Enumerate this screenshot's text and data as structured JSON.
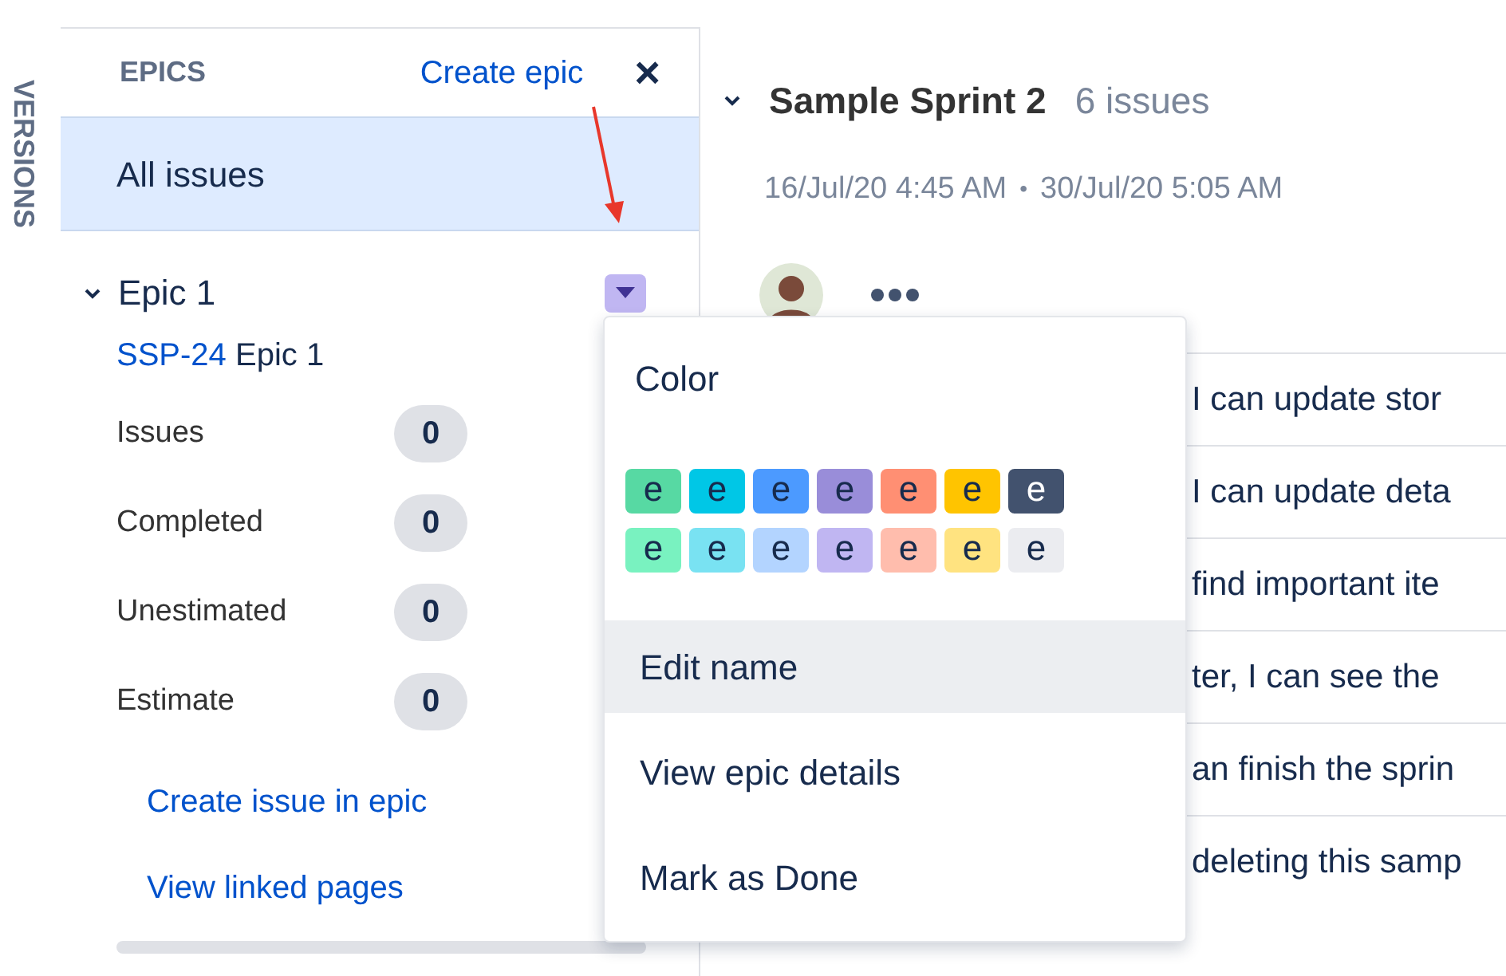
{
  "side_tab": {
    "label": "VERSIONS"
  },
  "epics_panel": {
    "title": "EPICS",
    "create_link": "Create epic",
    "close": "×",
    "all_issues": {
      "label": "All issues",
      "selected": true
    },
    "epic": {
      "name": "Epic 1",
      "expanded": true,
      "key": "SSP-24",
      "summary": "Epic 1",
      "color": "#c0b6f2",
      "stats": [
        {
          "label": "Issues",
          "count": "0"
        },
        {
          "label": "Completed",
          "count": "0"
        },
        {
          "label": "Unestimated",
          "count": "0"
        },
        {
          "label": "Estimate",
          "count": "0"
        }
      ],
      "links": [
        "Create issue in epic",
        "View linked pages"
      ]
    }
  },
  "sprint": {
    "name": "Sample Sprint 2",
    "count": "6 issues",
    "expanded": true,
    "start": "16/Jul/20 4:45 AM",
    "separator": "•",
    "end": "30/Jul/20 5:05 AM",
    "issues": [
      "I can update stor",
      "I can update deta",
      "find important ite",
      "ter, I can see the",
      "an finish the sprin",
      "deleting this samp"
    ]
  },
  "menu": {
    "color_heading": "Color",
    "swatches": [
      [
        {
          "label": "e",
          "color": "#57d9a3"
        },
        {
          "label": "e",
          "color": "#00c7e6"
        },
        {
          "label": "e",
          "color": "#4c9aff"
        },
        {
          "label": "e",
          "color": "#998dd9"
        },
        {
          "label": "e",
          "color": "#ff8f73"
        },
        {
          "label": "e",
          "color": "#ffc400"
        },
        {
          "label": "e",
          "color": "#42526e"
        }
      ],
      [
        {
          "label": "e",
          "color": "#79f2c0"
        },
        {
          "label": "e",
          "color": "#79e2f2"
        },
        {
          "label": "e",
          "color": "#b3d4ff"
        },
        {
          "label": "e",
          "color": "#c0b6f2"
        },
        {
          "label": "e",
          "color": "#ffbdad"
        },
        {
          "label": "e",
          "color": "#ffe380"
        },
        {
          "label": "e",
          "color": "#ebecf0"
        }
      ]
    ],
    "items": [
      {
        "label": "Edit name",
        "selected": true
      },
      {
        "label": "View epic details",
        "selected": false
      },
      {
        "label": "Mark as Done",
        "selected": false
      }
    ]
  }
}
